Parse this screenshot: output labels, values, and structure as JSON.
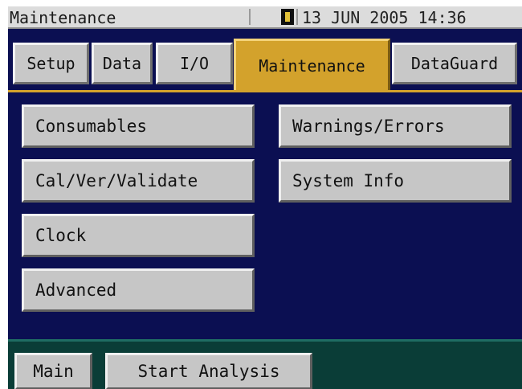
{
  "window": {
    "title": "Maintenance"
  },
  "status": {
    "icon": "status-indicator-icon",
    "datetime": "13 JUN 2005 14:36"
  },
  "tabs": [
    {
      "label": "Setup"
    },
    {
      "label": "Data"
    },
    {
      "label": "I/O"
    },
    {
      "label": "Maintenance",
      "active": true
    },
    {
      "label": "DataGuard"
    }
  ],
  "buttons": {
    "left": [
      "Consumables",
      "Cal/Ver/Validate",
      "Clock",
      "Advanced"
    ],
    "right": [
      "Warnings/Errors",
      "System Info"
    ]
  },
  "bottom": {
    "main": "Main",
    "start": "Start Analysis"
  },
  "colors": {
    "screen_bg": "#0b0f52",
    "active_tab": "#d3a22c",
    "button_face": "#c6c6c6",
    "bottom_bar": "#0a3d37"
  }
}
